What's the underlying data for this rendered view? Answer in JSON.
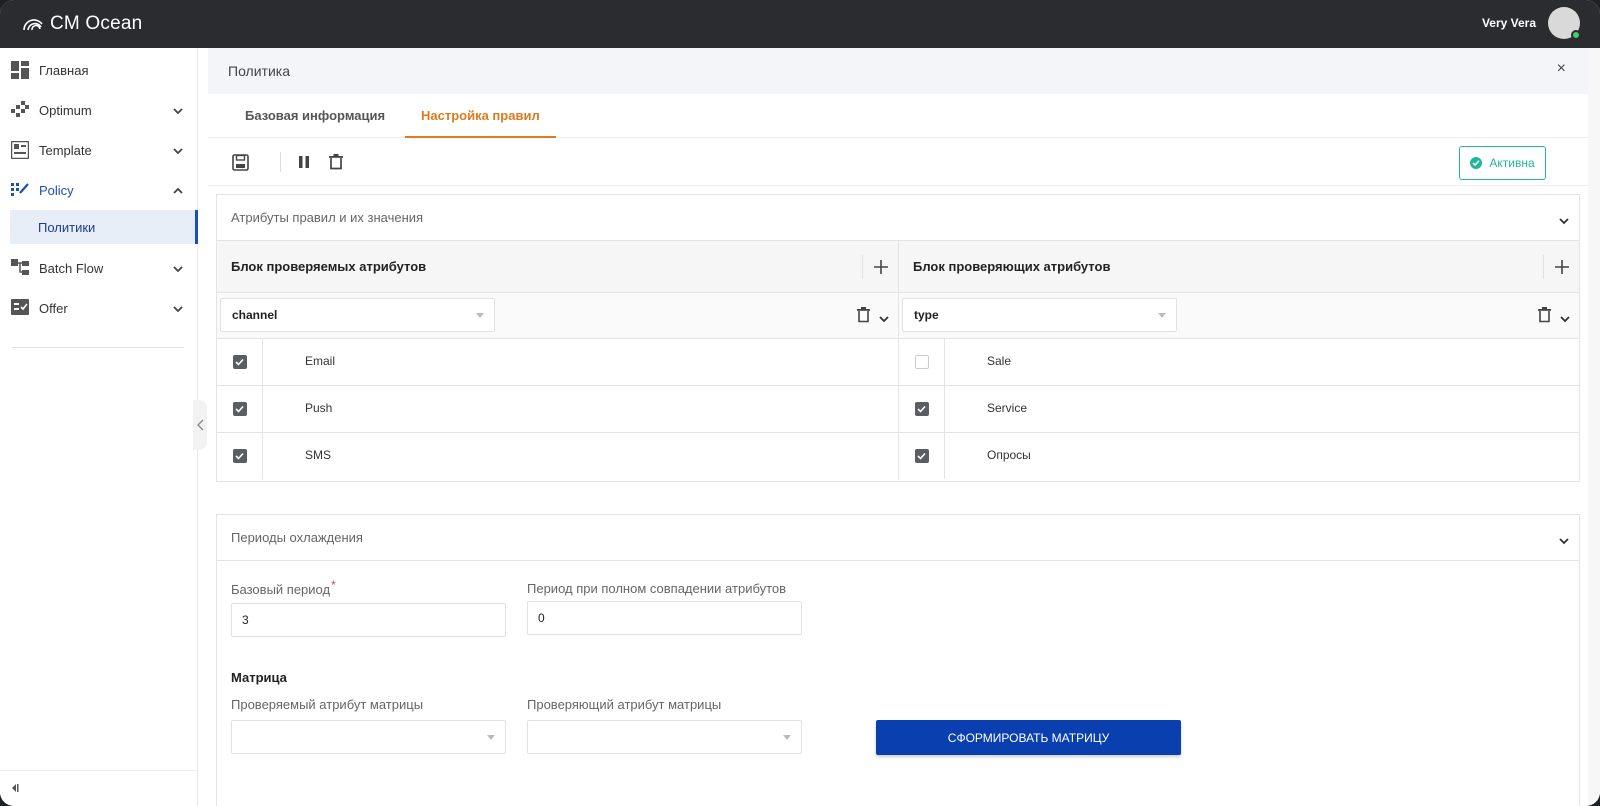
{
  "app": {
    "logo_text": "CM Ocean",
    "user_name": "Very Vera"
  },
  "sidebar": {
    "items": [
      {
        "label": "Главная",
        "icon": "dashboard-icon"
      },
      {
        "label": "Optimum",
        "icon": "optimum-icon"
      },
      {
        "label": "Template",
        "icon": "template-icon"
      },
      {
        "label": "Policy",
        "icon": "policy-icon"
      },
      {
        "label": "Политики"
      },
      {
        "label": "Batch Flow",
        "icon": "batch-flow-icon"
      },
      {
        "label": "Offer",
        "icon": "offer-icon"
      }
    ]
  },
  "panel": {
    "title": "Политика",
    "close_label": "×"
  },
  "tabs": [
    {
      "label": "Базовая информация",
      "active": false
    },
    {
      "label": "Настройка правил",
      "active": true
    }
  ],
  "toolbar": {
    "status_label": "Активна"
  },
  "attributes": {
    "title": "Атрибуты правил и их значения",
    "left": {
      "header": "Блок проверяемых атрибутов",
      "select_value": "channel",
      "options": [
        {
          "label": "Email",
          "checked": true
        },
        {
          "label": "Push",
          "checked": true
        },
        {
          "label": "SMS",
          "checked": true
        }
      ]
    },
    "right": {
      "header": "Блок проверяющих атрибутов",
      "select_value": "type",
      "options": [
        {
          "label": "Sale",
          "checked": false
        },
        {
          "label": "Service",
          "checked": true
        },
        {
          "label": "Опросы",
          "checked": true
        }
      ]
    }
  },
  "cooling": {
    "title": "Периоды охлаждения",
    "base_label": "Базовый период",
    "base_required": "*",
    "base_value": "3",
    "full_match_label": "Период при полном совпадении атрибутов",
    "full_match_value": "0",
    "matrix_title": "Матрица",
    "checked_attr_label": "Проверяемый атрибут матрицы",
    "checking_attr_label": "Проверяющий атрибут матрицы",
    "build_button": "СФОРМИРОВАТЬ МАТРИЦУ"
  },
  "colors": {
    "accent_orange": "#e07a1e",
    "active_green": "#22b59a",
    "primary_blue": "#0a3fb0",
    "topbar": "#2b2c2f"
  }
}
